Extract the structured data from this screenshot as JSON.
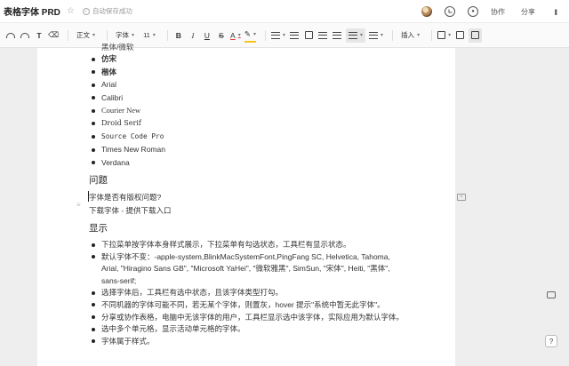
{
  "header": {
    "title": "表格字体 PRD",
    "autosave_text": "自动保存成功",
    "collab_label": "协作",
    "share_label": "分享"
  },
  "toolbar": {
    "style_label": "正文",
    "font_label": "字体",
    "size_label": "11",
    "bold_label": "B",
    "italic_label": "I",
    "underline_label": "U",
    "strike_label": "S",
    "color_label": "A",
    "insert_label": "插入"
  },
  "doc": {
    "cut_text": "黑体/微软",
    "fonts": [
      "仿宋",
      "楷体",
      "Arial",
      "Calibri",
      "Courier New",
      "Droid Serif",
      "Source Code Pro",
      "Times New Roman",
      "Verdana"
    ],
    "section_issues": "问题",
    "issue_q": "字体是否有版权问题?",
    "issue_a": "下载字体 - 提供下载入口",
    "section_display": "显示",
    "notes": [
      "下拉菜单按字体本身样式展示，下拉菜单有勾选状态，工具栏有显示状态。",
      "默认字体不变：-apple-system,BlinkMacSystemFont,PingFang SC, Helvetica, Tahoma, Arial, \"Hiragino Sans GB\", \"Microsoft YaHei\", \"微软雅黑\", SimSun, \"宋体\", Heiti, \"黑体\", sans-serif;",
      "选择字体后，工具栏有选中状态，且该字体类型打勾。",
      "不同机器的字体可能不同，若无某个字体，则置灰，hover 提示\"系统中暂无此字体\"。",
      "分享或协作表格，电脑中无该字体的用户，工具栏显示选中该字体，实际应用为默认字体。",
      "选中多个单元格，显示活动单元格的字体。",
      "字体属于样式。"
    ]
  },
  "help_label": "?"
}
